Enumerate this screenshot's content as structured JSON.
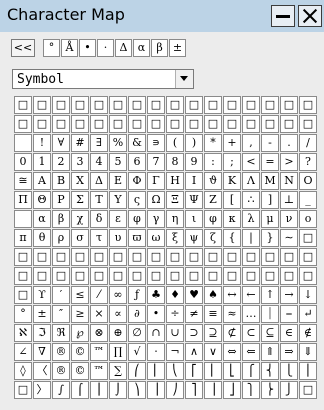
{
  "window": {
    "title": "Character Map",
    "minimize_icon": "minimize-icon",
    "close_icon": "close-icon"
  },
  "toolbar": {
    "back_label": "<<",
    "recent": [
      "°",
      "Å",
      "•",
      "·",
      "Δ",
      "α",
      "β",
      "±"
    ]
  },
  "font_select": {
    "value": "Symbol"
  },
  "grid": {
    "rows": [
      [
        "□",
        "□",
        "□",
        "□",
        "□",
        "□",
        "□",
        "□",
        "□",
        "□",
        "□",
        "□",
        "□",
        "□",
        "□",
        "□"
      ],
      [
        "□",
        "□",
        "□",
        "□",
        "□",
        "□",
        "□",
        "□",
        "□",
        "□",
        "□",
        "□",
        "□",
        "□",
        "□",
        "□"
      ],
      [
        "",
        "!",
        "∀",
        "#",
        "∃",
        "%",
        "&",
        "∍",
        "(",
        ")",
        "*",
        "+",
        ",",
        "-",
        ".",
        "/"
      ],
      [
        "0",
        "1",
        "2",
        "3",
        "4",
        "5",
        "6",
        "7",
        "8",
        "9",
        ":",
        ";",
        "<",
        "=",
        ">",
        "?"
      ],
      [
        "≅",
        "Α",
        "Β",
        "Χ",
        "Δ",
        "Ε",
        "Φ",
        "Γ",
        "Η",
        "Ι",
        "ϑ",
        "Κ",
        "Λ",
        "Μ",
        "Ν",
        "Ο"
      ],
      [
        "Π",
        "Θ",
        "Ρ",
        "Σ",
        "Τ",
        "Υ",
        "ς",
        "Ω",
        "Ξ",
        "Ψ",
        "Ζ",
        "[",
        "∴",
        "]",
        "⊥",
        "_"
      ],
      [
        "",
        "α",
        "β",
        "χ",
        "δ",
        "ε",
        "φ",
        "γ",
        "η",
        "ι",
        "φ",
        "κ",
        "λ",
        "μ",
        "ν",
        "ο"
      ],
      [
        "π",
        "θ",
        "ρ",
        "σ",
        "τ",
        "υ",
        "ϖ",
        "ω",
        "ξ",
        "ψ",
        "ζ",
        "{",
        "|",
        "}",
        "∼",
        "□"
      ],
      [
        "□",
        "□",
        "□",
        "□",
        "□",
        "□",
        "□",
        "□",
        "□",
        "□",
        "□",
        "□",
        "□",
        "□",
        "□",
        "□"
      ],
      [
        "□",
        "□",
        "□",
        "□",
        "□",
        "□",
        "□",
        "□",
        "□",
        "□",
        "□",
        "□",
        "□",
        "□",
        "□",
        "□"
      ],
      [
        "□",
        "ϒ",
        "′",
        "≤",
        "⁄",
        "∞",
        "ƒ",
        "♣",
        "♦",
        "♥",
        "♠",
        "↔",
        "←",
        "↑",
        "→",
        "↓"
      ],
      [
        "°",
        "±",
        "″",
        "≥",
        "×",
        "∝",
        "∂",
        "•",
        "÷",
        "≠",
        "≡",
        "≈",
        "…",
        "⏐",
        "⎯",
        "↵"
      ],
      [
        "ℵ",
        "ℑ",
        "ℜ",
        "℘",
        "⊗",
        "⊕",
        "∅",
        "∩",
        "∪",
        "⊃",
        "⊇",
        "⊄",
        "⊂",
        "⊆",
        "∈",
        "∉"
      ],
      [
        "∠",
        "∇",
        "®",
        "©",
        "™",
        "∏",
        "√",
        "⋅",
        "¬",
        "∧",
        "∨",
        "⇔",
        "⇐",
        "⇑",
        "⇒",
        "⇓"
      ],
      [
        "◊",
        "〈",
        "®",
        "©",
        "™",
        "∑",
        "⎛",
        "⎜",
        "⎝",
        "⎡",
        "⎢",
        "⎣",
        "⎧",
        "⎨",
        "⎩",
        "⎪"
      ],
      [
        "□",
        "〉",
        "∫",
        "⌠",
        "⎮",
        "⌡",
        "⎞",
        "⎟",
        "⎠",
        "⎤",
        "⎥",
        "⎦",
        "⎫",
        "⎬",
        "⎭",
        "□"
      ]
    ]
  }
}
